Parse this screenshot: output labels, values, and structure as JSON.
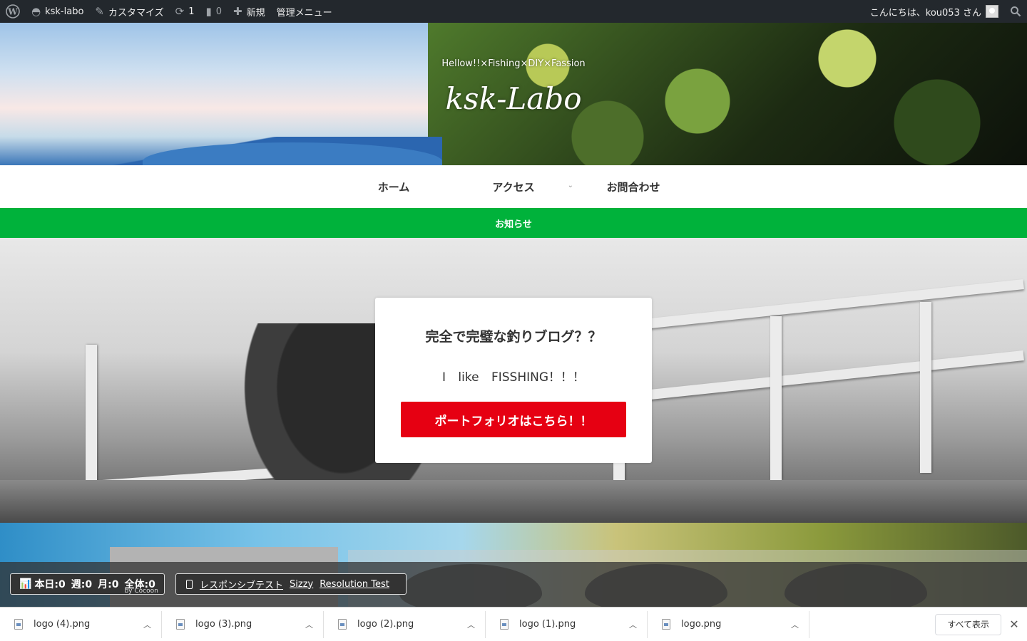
{
  "admin_bar": {
    "site_name": "ksk-labo",
    "customize": "カスタマイズ",
    "updates_count": "1",
    "comments_count": "0",
    "new_label": "新規",
    "admin_menu": "管理メニュー",
    "greeting": "こんにちは、kou053 さん"
  },
  "header": {
    "tagline": "Hellow!!×Fishing×DIY×Fassion",
    "site_title": "ksk-Labo"
  },
  "nav": {
    "items": [
      {
        "label": "ホーム"
      },
      {
        "label": "アクセス"
      },
      {
        "label": "お問合わせ"
      }
    ]
  },
  "notice": {
    "text": "お知らせ"
  },
  "cta": {
    "title": "完全で完璧な釣りブログ？？",
    "text": "I like FISSHING！！！",
    "button": "ポートフォリオはこちら！！"
  },
  "access_counter": {
    "today": "本日:0",
    "week": "週:0",
    "month": "月:0",
    "total": "全体:0",
    "by": "by Cocoon"
  },
  "responsive_tools": {
    "responsive_test": "レスポンシブテスト",
    "sizzy": "Sizzy",
    "resolution_test": "Resolution Test"
  },
  "downloads": {
    "items": [
      {
        "name": "logo (4).png"
      },
      {
        "name": "logo (3).png"
      },
      {
        "name": "logo (2).png"
      },
      {
        "name": "logo (1).png"
      },
      {
        "name": "logo.png"
      }
    ],
    "show_all": "すべて表示"
  },
  "colors": {
    "admin_bar": "#23282d",
    "notice_bar": "#00b23b",
    "cta_button": "#e60012"
  }
}
